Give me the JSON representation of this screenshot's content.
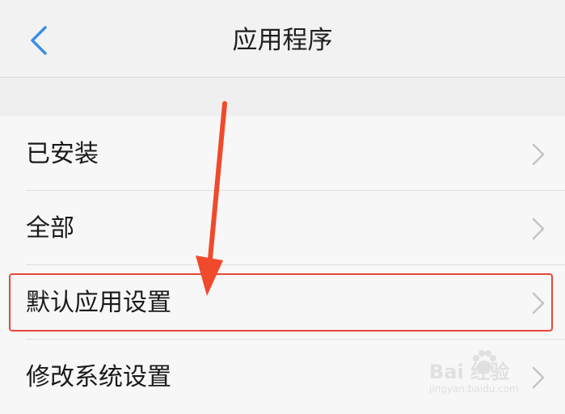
{
  "header": {
    "title": "应用程序",
    "back_icon": "chevron-left-icon",
    "accent_color": "#3a8ee6"
  },
  "list": {
    "items": [
      {
        "label": "已安装",
        "icon": "chevron-right-icon"
      },
      {
        "label": "全部",
        "icon": "chevron-right-icon"
      },
      {
        "label": "默认应用设置",
        "icon": "chevron-right-icon"
      },
      {
        "label": "修改系统设置",
        "icon": "chevron-right-icon"
      }
    ]
  },
  "annotation": {
    "highlight_color": "#e8463a"
  },
  "watermark": {
    "brand": "Bai  经验",
    "url": "jingyan.baidu.com"
  }
}
